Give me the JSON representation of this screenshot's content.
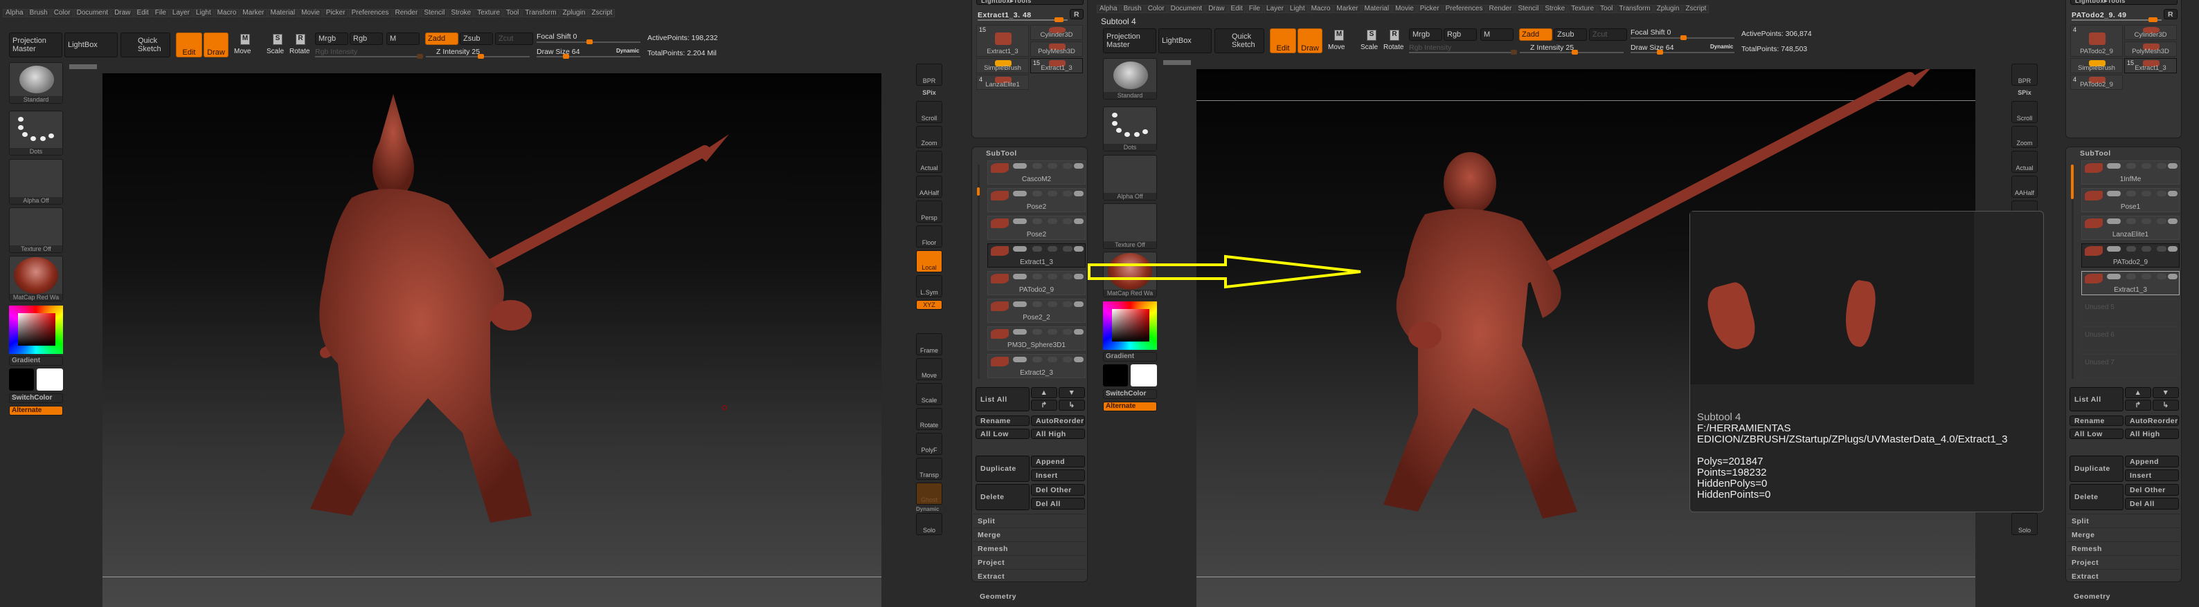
{
  "menu": [
    "Alpha",
    "Brush",
    "Color",
    "Document",
    "Draw",
    "Edit",
    "File",
    "Layer",
    "Light",
    "Macro",
    "Marker",
    "Material",
    "Movie",
    "Picker",
    "Preferences",
    "Render",
    "Stencil",
    "Stroke",
    "Texture",
    "Tool",
    "Transform",
    "Zplugin",
    "Zscript"
  ],
  "toolbar": {
    "projection_master": "Projection Master",
    "lightbox": "LightBox",
    "quick_sketch": "Quick Sketch",
    "edit": "Edit",
    "draw": "Draw",
    "move": "Move",
    "scale": "Scale",
    "rotate": "Rotate",
    "mrgb": "Mrgb",
    "rgb": "Rgb",
    "m": "M",
    "zadd": "Zadd",
    "zsub": "Zsub",
    "zcut": "Zcut",
    "rgb_intensity": "Rgb Intensity",
    "z_intensity": "Z Intensity 25",
    "focal_shift": "Focal Shift 0",
    "draw_size": "Draw Size 64",
    "dynamic": "Dynamic"
  },
  "shelf": {
    "brush": "Standard",
    "stroke": "Dots",
    "alpha": "Alpha Off",
    "texture": "Texture Off",
    "material": "MatCap Red Wa",
    "gradient": "Gradient",
    "switch_color": "SwitchColor",
    "alternate": "Alternate"
  },
  "vtools": [
    "BPR",
    "SPix",
    "Scroll",
    "Zoom",
    "Actual",
    "AAHalf",
    "Persp",
    "Floor",
    "Local",
    "L.Sym",
    "XYZ",
    "Frame",
    "Move",
    "Scale",
    "Rotate",
    "PolyF",
    "Transp",
    "Ghost",
    "Solo"
  ],
  "vtools_dynamic": "Dynamic",
  "panel_labels": {
    "lightbox_tools": "Lightbox▸Tools",
    "r": "R",
    "subtool": "SubTool",
    "list_all": "List All",
    "rename": "Rename",
    "autoreorder": "AutoReorder",
    "all_low": "All Low",
    "all_high": "All High",
    "duplicate": "Duplicate",
    "append": "Append",
    "insert": "Insert",
    "delete": "Delete",
    "del_other": "Del Other",
    "del_all": "Del All",
    "split": "Split",
    "merge": "Merge",
    "remesh": "Remesh",
    "project": "Project",
    "extract": "Extract",
    "geometry": "Geometry"
  },
  "left": {
    "stats": {
      "active": "ActivePoints: 198,232",
      "total": "TotalPoints: 2.204 Mil"
    },
    "tool_name": "Extract1_3. 48",
    "tools": [
      {
        "count": "15",
        "name": "Extract1_3"
      },
      {
        "count": "",
        "name": "Cylinder3D"
      },
      {
        "count": "",
        "name": "PolyMesh3D"
      },
      {
        "count": "",
        "name": "SimpleBrush"
      },
      {
        "count": "15",
        "name": "Extract1_3"
      },
      {
        "count": "4",
        "name": "LanzaElite1"
      }
    ],
    "subtools": [
      {
        "name": "CascoM2"
      },
      {
        "name": "Pose2"
      },
      {
        "name": "Pose2"
      },
      {
        "name": "Extract1_3",
        "state": "sel"
      },
      {
        "name": "PATodo2_9"
      },
      {
        "name": "Pose2_2"
      },
      {
        "name": "PM3D_Sphere3D1"
      },
      {
        "name": "Extract2_3"
      }
    ]
  },
  "right": {
    "subtool_title": "Subtool 4",
    "stats": {
      "active": "ActivePoints: 306,874",
      "total": "TotalPoints: 748,503"
    },
    "tool_name": "PATodo2_9. 49",
    "tools": [
      {
        "count": "4",
        "name": "PATodo2_9"
      },
      {
        "count": "",
        "name": "Cylinder3D"
      },
      {
        "count": "",
        "name": "PolyMesh3D"
      },
      {
        "count": "",
        "name": "SimpleBrush"
      },
      {
        "count": "15",
        "name": "Extract1_3"
      },
      {
        "count": "4",
        "name": "PATodo2_9"
      }
    ],
    "subtools": [
      {
        "name": "1InfMe"
      },
      {
        "name": "Pose1"
      },
      {
        "name": "LanzaElite1"
      },
      {
        "name": "PATodo2_9",
        "state": "sel"
      },
      {
        "name": "Extract1_3",
        "state": "out"
      },
      {
        "name": "Unused 5",
        "state": "unused"
      },
      {
        "name": "Unused 6",
        "state": "unused"
      },
      {
        "name": "Unused 7",
        "state": "unused"
      }
    ]
  },
  "info": {
    "title": "Subtool 4",
    "path1": "F:/HERRAMIENTAS",
    "path2": "EDICION/ZBRUSH/ZStartup/ZPlugs/UVMasterData_4.0/Extract1_3",
    "polys": "Polys=201847",
    "points": "Points=198232",
    "hidden_polys": "HiddenPolys=0",
    "hidden_points": "HiddenPoints=0"
  },
  "colors": {
    "accent": "#f07800",
    "model": "#8a3326",
    "arrow": "#ffff00"
  }
}
